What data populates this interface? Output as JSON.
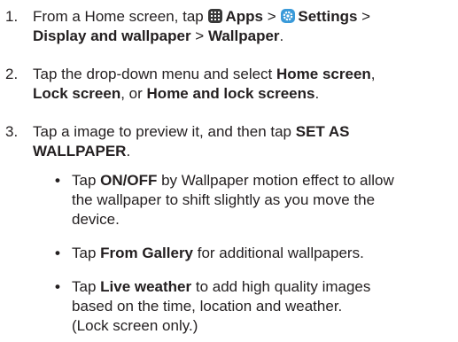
{
  "steps": [
    {
      "number": "1.",
      "line1_pre": "From a Home screen, tap",
      "apps_label": "Apps",
      "sep1": " > ",
      "settings_label": "Settings",
      "sep2": " >",
      "line2_bold1": "Display and wallpaper",
      "sep3": " > ",
      "line2_bold2": "Wallpaper",
      "line2_end": "."
    },
    {
      "number": "2.",
      "line1_pre": "Tap the drop-down menu and select ",
      "line1_bold": "Home screen",
      "line1_post": ",",
      "line2_bold1": "Lock screen",
      "line2_mid": ", or ",
      "line2_bold2": "Home and lock screens",
      "line2_end": "."
    },
    {
      "number": "3.",
      "line1_pre": "Tap a image to preview it, and then tap ",
      "line1_bold": "SET AS",
      "line2_bold": "WALLPAPER",
      "line2_end": "."
    }
  ],
  "bullets": [
    {
      "symbol": "•",
      "line1_pre": "Tap ",
      "line1_bold": "ON/OFF",
      "line1_post": " by Wallpaper motion effect to allow",
      "line2": "the wallpaper to shift slightly as you move the",
      "line3": "device."
    },
    {
      "symbol": "•",
      "line1_pre": "Tap ",
      "line1_bold": "From Gallery",
      "line1_post": " for additional wallpapers."
    },
    {
      "symbol": "•",
      "line1_pre": "Tap ",
      "line1_bold": "Live weather",
      "line1_post": " to add high quality images",
      "line2": "based on the time, location and weather.",
      "line3": "(Lock screen only.)"
    }
  ],
  "icons": {
    "apps": "apps-grid-icon",
    "settings": "settings-gear-icon",
    "settings_color": "#3a9ad9"
  }
}
